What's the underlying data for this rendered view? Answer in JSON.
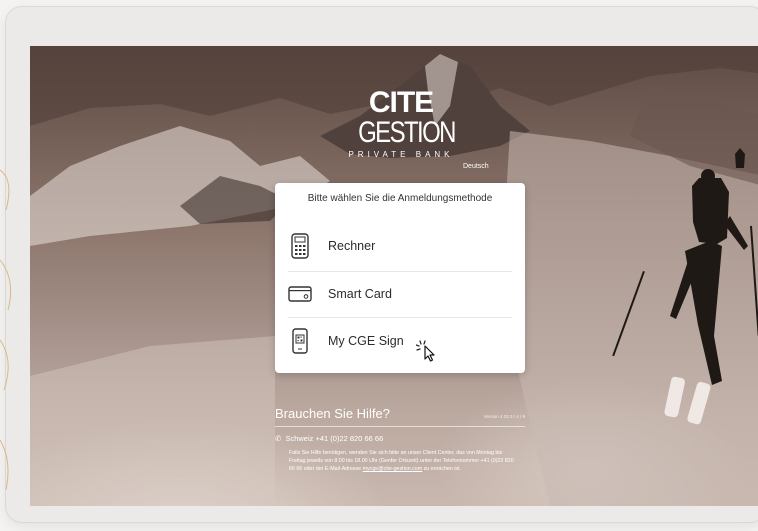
{
  "brand": {
    "name_bold": "CITE",
    "name_light": "GESTION",
    "subtitle": "PRIVATE BANK"
  },
  "language": "Deutsch",
  "login": {
    "prompt": "Bitte wählen Sie die Anmeldungsmethode",
    "options": [
      {
        "label": "Rechner",
        "icon": "calculator-icon"
      },
      {
        "label": "Smart Card",
        "icon": "smart-card-icon"
      },
      {
        "label": "My CGE Sign",
        "icon": "mobile-qr-icon"
      }
    ]
  },
  "help": {
    "title": "Brauchen Sie Hilfe?",
    "version": "Version 4.33.3 / 4 / 9",
    "phone": "Schweiz +41 (0)22 820 66 66",
    "text_before_link": "Falls Sie Hilfe benötigen, wenden Sie sich bitte an unser Client Center, das von Montag bis Freitag jeweils von 8.00 bis 18.00 Uhr (Genfer Ortszeit) unter der Telefonnummer +41 (0)22 820 66 66 oder der E-Mail-Adresse ",
    "email": "mycge@cite-gestion.com",
    "text_after_link": " zu erreichen ist."
  },
  "colors": {
    "overlay": "#7a6259",
    "card": "#ffffff",
    "text": "#2c2c2c"
  }
}
